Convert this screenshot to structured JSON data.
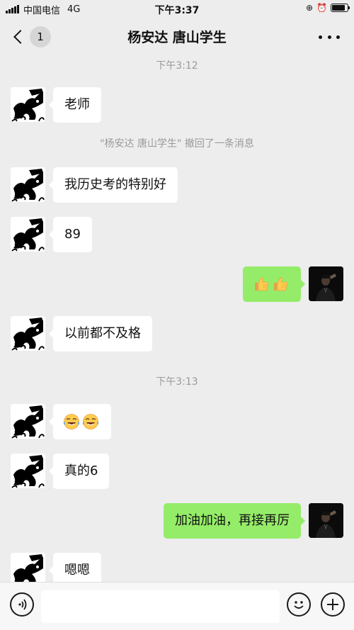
{
  "status_bar": {
    "carrier": "中国电信",
    "network": "4G",
    "time": "下午3:37",
    "battery_level": 0.85
  },
  "header": {
    "back_badge": "1",
    "title": "杨安达 唐山学生",
    "icons": [
      "back-chevron-icon",
      "more-icon"
    ]
  },
  "chat": {
    "time_1": "下午3:12",
    "msg_1": "老师",
    "recall_notice": "\"杨安达 唐山学生\" 撤回了一条消息",
    "msg_2": "我历史考的特别好",
    "msg_3": "89",
    "msg_4_emoji": [
      "thumbs-up",
      "thumbs-up"
    ],
    "msg_5": "以前都不及格",
    "time_2": "下午3:13",
    "msg_6_emoji": [
      "rolling-laughing",
      "rolling-laughing"
    ],
    "msg_7": "真的6",
    "msg_8": "加油加油，再接再厉",
    "msg_9": "嗯嗯"
  },
  "input_bar": {
    "icons": [
      "voice-icon",
      "emoji-icon",
      "plus-icon"
    ],
    "value": ""
  },
  "colors": {
    "background": "#ededed",
    "sent_bubble": "#95ec69",
    "received_bubble": "#ffffff",
    "timestamp": "#9a9a9a"
  }
}
